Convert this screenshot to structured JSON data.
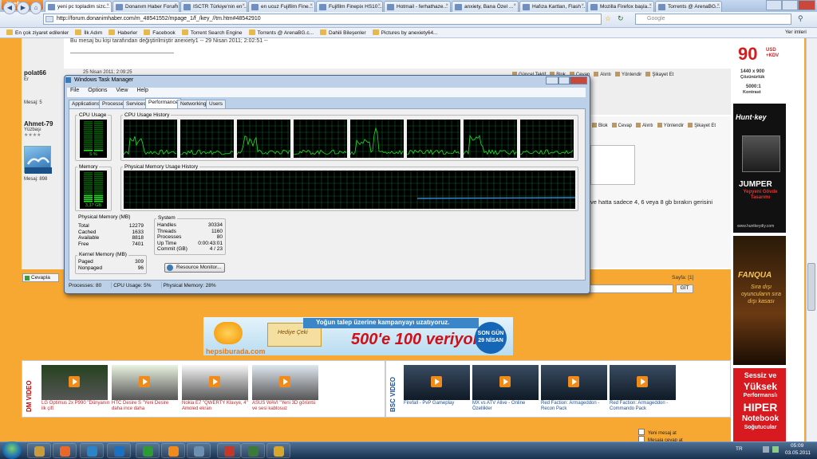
{
  "browser": {
    "app_button": "Firefox",
    "tabs": [
      "yeni pc topladim sizc...",
      "Donanım Haber Forum",
      "ISCTR Türkiye'nin en ...",
      "en ucuz Fujifilm Fine...",
      "Fujifilm Finepix HS10...",
      "Hotmail - ferhathaze...",
      "anxiety, Bana Özel ...",
      "Hafıza Kartları, Flash ...",
      "Mozilla Firefox başla...",
      "Torrents @ ArenaBG..."
    ],
    "url": "http://forum.donanimhaber.com/m_48541552/mpage_1/f_/key_//tm.htm#48542910",
    "search_placeholder": "Google",
    "bookmarks": [
      "En çok ziyaret edilenler",
      "İlk Adım",
      "Haberler",
      "Facebook",
      "Torrent Search Engine",
      "Torrents @ ArenaBG.c...",
      "Dahili Bileşenler",
      "Pictures by anexiety64..."
    ],
    "bookmarks_right": "Yer imleri"
  },
  "forum": {
    "quote_text": "Bu mesaj bu kişi tarafından değiştirilmiştir anexiety1 -- 29 Nisan 2011; 2:02:51 --",
    "post1": {
      "user": "polat66",
      "rank": "Er",
      "messages": "Mesaj: 5",
      "date": "25 Nisan 2011; 2:09:25",
      "actions": [
        "Güncel Teklif",
        "Blok",
        "Cevap",
        "Alıntı",
        "Yönlendir",
        "Şikayet Et"
      ]
    },
    "post2": {
      "user": "Ahmet-79",
      "rank": "Yüzbaşı",
      "stars": "★★★★",
      "messages": "Mesaj: 898",
      "actions": [
        "Blok",
        "Cevap",
        "Alıntı",
        "Yönlendir",
        "Şikayet Et"
      ],
      "text": "ve hatta sadece 4, 6 veya 8 gb bırakın gerisini"
    },
    "reply_button": "Cevapla",
    "page_label": "Sayfa: [1]",
    "go_button": "GİT"
  },
  "right_ads": {
    "price": "90",
    "price_unit": "USD +KDV",
    "spec1": "1440 x 900",
    "spec1b": "Çözünürlük",
    "spec2": "5000:1",
    "spec2b": "Kontrast",
    "huntkey_brand": "Hunt·key",
    "jumper": "JUMPER",
    "jumper_sub": "Yepyeni Gövde Tasarımı",
    "huntkey_url": "www.huntkeydiy.com",
    "fanqua": "FANQUA",
    "fanqua_text": "Sıra dışı oyuncuların sıra dışı kasası",
    "notebook": [
      "Sessiz ve",
      "Yüksek",
      "Performanslı",
      "HIPER",
      "Notebook",
      "Soğutucular"
    ]
  },
  "hepsiburada_ad": {
    "banner": "Yoğun talep üzerine kampanyayı uzatıyoruz.",
    "headline": "500'e 100 veriyoruz!",
    "badge": "SON GÜN 29 NİSAN",
    "voucher": "Hediye Çeki",
    "brand": "hepsiburada.com"
  },
  "videos": {
    "dm_label": "DM VIDEO",
    "bsc_label": "BSC VIDEO",
    "dm_items": [
      "LG Optimus 2x P990 \"Dünyanın ilk çift",
      "HTC Desire S \"Yeni Desire daha ince daha",
      "Nokia E7 \"QWERTY Klavye, 4\" Amoled ekran",
      "ASUS WAVI \"Yeni 3D görüntü ve sesi kablosuz"
    ],
    "bsc_items": [
      "Firefall - PvP Gameplay",
      "MX vs ATV Alive - Online Özellikler",
      "Red Faction: Armageddon - Recon Pack",
      "Red Faction: Armageddon - Commando Pack"
    ]
  },
  "checks": [
    "Yeni mesaj at",
    "Mesaja cevap at"
  ],
  "task_manager": {
    "title": "Windows Task Manager",
    "menu": [
      "File",
      "Options",
      "View",
      "Help"
    ],
    "tabs": [
      "Applications",
      "Processes",
      "Services",
      "Performance",
      "Networking",
      "Users"
    ],
    "active_tab": "Performance",
    "cpu_usage_label": "CPU Usage",
    "cpu_usage_value": "5 %",
    "cpu_history_label": "CPU Usage History",
    "memory_label": "Memory",
    "memory_value": "3,37 GB",
    "mem_history_label": "Physical Memory Usage History",
    "phys_mem_title": "Physical Memory (MB)",
    "phys_mem": [
      [
        "Total",
        "12279"
      ],
      [
        "Cached",
        "1633"
      ],
      [
        "Available",
        "8818"
      ],
      [
        "Free",
        "7401"
      ]
    ],
    "kernel_title": "Kernel Memory (MB)",
    "kernel": [
      [
        "Paged",
        "309"
      ],
      [
        "Nonpaged",
        "96"
      ]
    ],
    "system_title": "System",
    "system": [
      [
        "Handles",
        "30334"
      ],
      [
        "Threads",
        "1160"
      ],
      [
        "Processes",
        "80"
      ],
      [
        "Up Time",
        "0:00:43:01"
      ],
      [
        "Commit (GB)",
        "4 / 23"
      ]
    ],
    "resource_button": "Resource Monitor...",
    "status": [
      "Processes: 80",
      "CPU Usage: 5%",
      "Physical Memory: 28%"
    ]
  },
  "taskbar": {
    "lang": "TR",
    "time": "05:09",
    "date": "03.05.2011"
  }
}
